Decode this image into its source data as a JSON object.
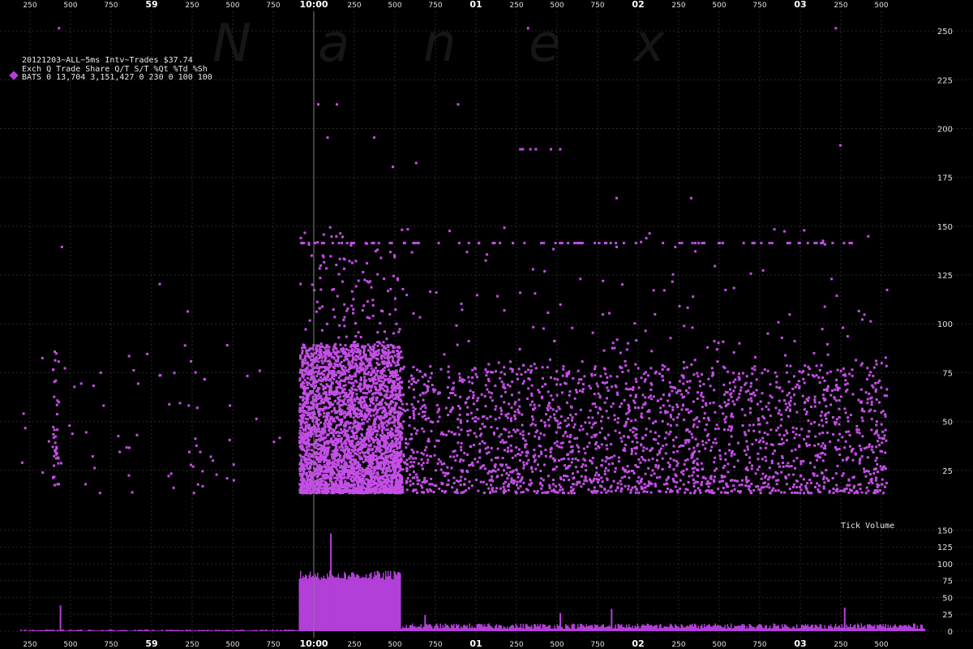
{
  "watermark": [
    "N",
    "a",
    "n",
    "e",
    "x"
  ],
  "info": {
    "title": "20121203~ALL~5ms Intv~Trades $37.74",
    "header": "Exch Q  Trade      Share  Q/T   S/T  %Qt %Td %Sh",
    "row": "BATS 0 13,704 3,151,427     0   230    0 100 100",
    "legend_color": "#b23fd8"
  },
  "chart_data": [
    {
      "type": "scatter",
      "name": "trade-size",
      "title": "",
      "ylim": [
        0,
        260
      ],
      "y_ticks": [
        "250",
        "225",
        "200",
        "175",
        "150",
        "125",
        "100",
        "75",
        "50",
        "25"
      ],
      "color": "#c44ee6",
      "clusters": [
        {
          "x0": 0.02,
          "x1": 0.3,
          "y0": 14,
          "y1": 90,
          "n": 70
        },
        {
          "x0": 0.055,
          "x1": 0.062,
          "y0": 18,
          "y1": 88,
          "n": 40
        },
        {
          "x0": 0.32,
          "x1": 0.43,
          "y0": 14,
          "y1": 90,
          "n": 3500
        },
        {
          "x0": 0.32,
          "x1": 0.43,
          "y0": 90,
          "y1": 150,
          "n": 120
        },
        {
          "x0": 0.43,
          "x1": 0.95,
          "y0": 14,
          "y1": 80,
          "n": 2200
        },
        {
          "x0": 0.43,
          "x1": 0.95,
          "y0": 80,
          "y1": 150,
          "n": 120
        }
      ],
      "rows": [
        {
          "y": 142,
          "x0": 0.32,
          "x1": 0.92,
          "n": 95
        },
        {
          "y": 190,
          "x0": 0.55,
          "x1": 0.6,
          "n": 6
        }
      ],
      "outliers": [
        [
          0.062,
          252
        ],
        [
          0.565,
          252
        ],
        [
          0.895,
          252
        ],
        [
          0.34,
          213
        ],
        [
          0.36,
          213
        ],
        [
          0.49,
          213
        ],
        [
          0.35,
          196
        ],
        [
          0.4,
          196
        ],
        [
          0.445,
          183
        ],
        [
          0.42,
          181
        ],
        [
          0.66,
          165
        ],
        [
          0.74,
          165
        ],
        [
          0.66,
          140
        ],
        [
          0.84,
          148
        ],
        [
          0.065,
          140
        ],
        [
          0.17,
          121
        ],
        [
          0.2,
          107
        ],
        [
          0.9,
          192
        ],
        [
          0.95,
          118
        ]
      ],
      "annotation": "Tick Volume"
    },
    {
      "type": "bar",
      "name": "tick-volume",
      "title": "",
      "ylim": [
        0,
        160
      ],
      "y_ticks": [
        "150",
        "125",
        "100",
        "75",
        "50",
        "25",
        "0"
      ],
      "color": "#b23fd8",
      "segments": [
        {
          "x0": 0.0,
          "x1": 0.32,
          "base": 1,
          "noise": 2
        },
        {
          "x0": 0.32,
          "x1": 0.43,
          "base": 80,
          "noise": 14
        },
        {
          "x0": 0.43,
          "x1": 1.0,
          "base": 6,
          "noise": 8
        }
      ],
      "spikes": [
        [
          0.064,
          38
        ],
        [
          0.354,
          145
        ],
        [
          0.905,
          35
        ],
        [
          0.655,
          33
        ],
        [
          0.6,
          27
        ],
        [
          0.455,
          24
        ]
      ]
    }
  ],
  "x_axis": {
    "labels": [
      "250",
      "500",
      "750",
      "59",
      "250",
      "500",
      "750",
      "10:00",
      "250",
      "500",
      "750",
      "01",
      "250",
      "500",
      "750",
      "02",
      "250",
      "500",
      "750",
      "03",
      "250",
      "500"
    ],
    "bold": [
      "59",
      "10:00",
      "01",
      "02",
      "03"
    ]
  }
}
